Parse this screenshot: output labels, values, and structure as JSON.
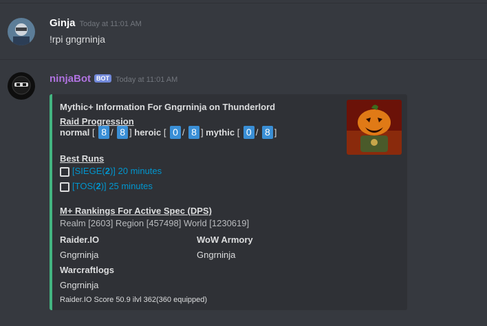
{
  "messages": [
    {
      "author": "Ginja",
      "timestamp": "Today at 11:01 AM",
      "content": "!rpi gngrninja"
    },
    {
      "author": "ninjaBot",
      "badge": "BOT",
      "timestamp": "Today at 11:01 AM"
    }
  ],
  "embed": {
    "title": "Mythic+ Information For Gngrninja on Thunderlord",
    "raid_progression": {
      "heading": "Raid Progression",
      "difficulties": [
        {
          "label": "normal",
          "done": "8",
          "total": "8"
        },
        {
          "label": "heroic",
          "done": "0",
          "total": "8"
        },
        {
          "label": "mythic",
          "done": "0",
          "total": "8"
        }
      ]
    },
    "best_runs": {
      "heading": "Best Runs",
      "runs": [
        {
          "dungeon": "SIEGE",
          "level": "2",
          "time": "20 minutes"
        },
        {
          "dungeon": "TOS",
          "level": "2",
          "time": "25 minutes"
        }
      ]
    },
    "rankings": {
      "heading": "M+ Rankings For Active Spec (DPS)",
      "text": "Realm [2603] Region [457498] World [1230619]"
    },
    "fields": [
      {
        "name": "Raider.IO",
        "value": "Gngrninja"
      },
      {
        "name": "WoW Armory",
        "value": "Gngrninja"
      },
      {
        "name": "Warcraftlogs",
        "value": "Gngrninja"
      }
    ],
    "footer": "Raider.IO Score 50.9 ilvl 362(360 equipped)"
  },
  "colors": {
    "background": "#36393f",
    "embed_bg": "#2f3136",
    "embed_accent": "#43b581",
    "bot_name": "#b073e0",
    "link": "#0096cf",
    "number_box": "#3a8fd6"
  }
}
